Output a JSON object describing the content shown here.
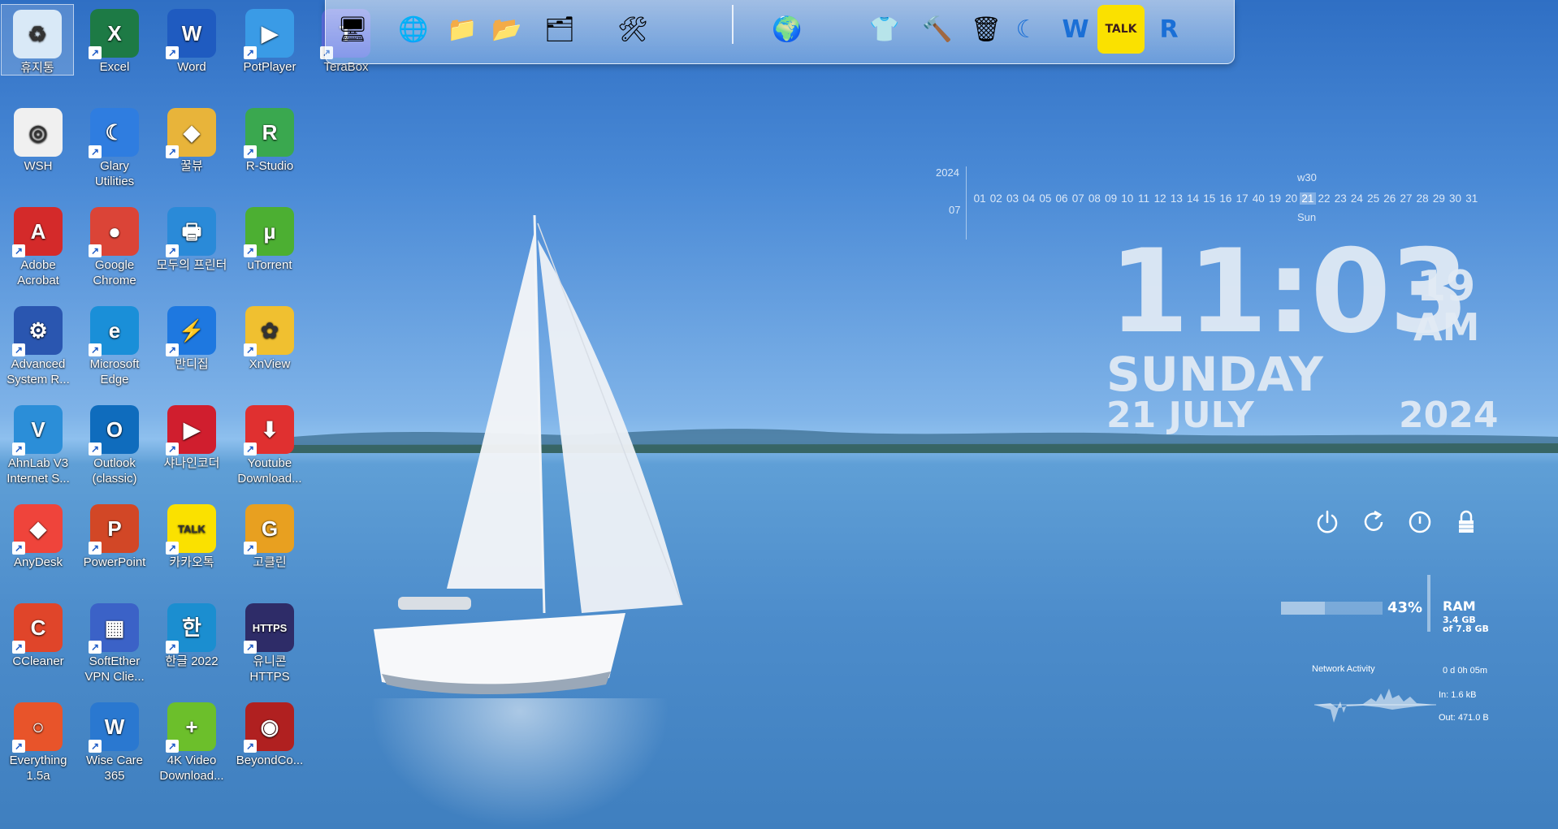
{
  "desktop": {
    "icons": [
      {
        "label": "휴지통",
        "icon": "recycle-bin-icon",
        "color": "#d9e9f7",
        "glyph": "♻"
      },
      {
        "label": "Excel",
        "icon": "excel-icon",
        "color": "#1d7a45",
        "glyph": "X"
      },
      {
        "label": "Word",
        "icon": "word-icon",
        "color": "#1f5bc0",
        "glyph": "W"
      },
      {
        "label": "PotPlayer",
        "icon": "potplayer-icon",
        "color": "#3a9be6",
        "glyph": "▶"
      },
      {
        "label": "TeraBox",
        "icon": "terabox-icon",
        "color": "#5b6de0",
        "glyph": "T"
      },
      {
        "label": "WSH",
        "icon": "wsh-icon",
        "color": "#f0f0f0",
        "glyph": "◎"
      },
      {
        "label": "Glary Utilities",
        "icon": "glary-utilities-icon",
        "color": "#2f7de0",
        "glyph": "☾"
      },
      {
        "label": "꿀뷰",
        "icon": "honeyview-icon",
        "color": "#e8b43a",
        "glyph": "◆"
      },
      {
        "label": "R-Studio",
        "icon": "r-studio-icon",
        "color": "#3aa84f",
        "glyph": "R"
      },
      {
        "label": "Adobe Acrobat",
        "icon": "adobe-acrobat-icon",
        "color": "#d42a2a",
        "glyph": "A"
      },
      {
        "label": "Google Chrome",
        "icon": "chrome-icon",
        "color": "#db4437",
        "glyph": "●"
      },
      {
        "label": "모두의 프린터",
        "icon": "printer-icon",
        "color": "#2a8ad8",
        "glyph": "🖶"
      },
      {
        "label": "uTorrent",
        "icon": "utorrent-icon",
        "color": "#4caf32",
        "glyph": "µ"
      },
      {
        "label": "Advanced System R...",
        "icon": "advanced-system-repair-icon",
        "color": "#2a56b0",
        "glyph": "⚙"
      },
      {
        "label": "Microsoft Edge",
        "icon": "edge-icon",
        "color": "#1a8fd8",
        "glyph": "e"
      },
      {
        "label": "반디집",
        "icon": "bandizip-icon",
        "color": "#1e78e0",
        "glyph": "⚡"
      },
      {
        "label": "XnView",
        "icon": "xnview-icon",
        "color": "#f0c030",
        "glyph": "✿"
      },
      {
        "label": "AhnLab V3 Internet S...",
        "icon": "ahnlab-v3-icon",
        "color": "#2b8ed8",
        "glyph": "V"
      },
      {
        "label": "Outlook (classic)",
        "icon": "outlook-icon",
        "color": "#0f6cbd",
        "glyph": "O"
      },
      {
        "label": "샤나인코더",
        "icon": "shana-encoder-icon",
        "color": "#d01e2e",
        "glyph": "▶"
      },
      {
        "label": "Youtube Download...",
        "icon": "youtube-downloader-icon",
        "color": "#e03030",
        "glyph": "⬇"
      },
      {
        "label": "AnyDesk",
        "icon": "anydesk-icon",
        "color": "#ef443b",
        "glyph": "◆"
      },
      {
        "label": "PowerPoint",
        "icon": "powerpoint-icon",
        "color": "#d24726",
        "glyph": "P"
      },
      {
        "label": "카카오톡",
        "icon": "kakaotalk-icon",
        "color": "#fae100",
        "glyph": "TALK"
      },
      {
        "label": "고클린",
        "icon": "goclean-icon",
        "color": "#e8a020",
        "glyph": "G"
      },
      {
        "label": "CCleaner",
        "icon": "ccleaner-icon",
        "color": "#e0452a",
        "glyph": "C"
      },
      {
        "label": "SoftEther VPN Clie...",
        "icon": "softether-vpn-icon",
        "color": "#3b62c7",
        "glyph": "▦"
      },
      {
        "label": "한글 2022",
        "icon": "hangul-icon",
        "color": "#1b8ed0",
        "glyph": "한"
      },
      {
        "label": "유니콘 HTTPS",
        "icon": "unicorn-https-icon",
        "color": "#2e2c68",
        "glyph": "HTTPS"
      },
      {
        "label": "Everything 1.5a",
        "icon": "everything-search-icon",
        "color": "#e8542a",
        "glyph": "○"
      },
      {
        "label": "Wise Care 365",
        "icon": "wise-care-icon",
        "color": "#2a78d0",
        "glyph": "W"
      },
      {
        "label": "4K Video Download...",
        "icon": "4k-video-downloader-icon",
        "color": "#6cbf2b",
        "glyph": "+"
      },
      {
        "label": "BeyondCo...",
        "icon": "beyond-compare-icon",
        "color": "#b02020",
        "glyph": "◉"
      }
    ]
  },
  "dock": {
    "items": [
      {
        "icon": "computer-icon",
        "glyph": "🖥"
      },
      {
        "icon": "network-globe-icon",
        "glyph": "🌐"
      },
      {
        "icon": "folder-icon",
        "glyph": "📁"
      },
      {
        "icon": "folder-icon",
        "glyph": "📂"
      },
      {
        "icon": "documents-folder-icon",
        "glyph": "🗂"
      },
      {
        "icon": "tools-icon",
        "glyph": "🛠"
      },
      {
        "icon": "globe-icon",
        "glyph": "🌍"
      },
      {
        "icon": "tshirt-icon",
        "glyph": "👕"
      },
      {
        "icon": "hammer-icon",
        "glyph": "🔨"
      },
      {
        "icon": "recycle-bin-icon",
        "glyph": "🗑"
      },
      {
        "icon": "glary-utilities-icon",
        "glyph": "☾"
      },
      {
        "icon": "wise-care-icon",
        "glyph": "W"
      },
      {
        "icon": "kakaotalk-icon",
        "glyph": "TALK"
      },
      {
        "icon": "r-studio-icon",
        "glyph": "R"
      }
    ]
  },
  "calendar": {
    "year": "2024",
    "month": "07",
    "week": "w30",
    "days": [
      "01",
      "02",
      "03",
      "04",
      "05",
      "06",
      "07",
      "08",
      "09",
      "10",
      "11",
      "12",
      "13",
      "14",
      "15",
      "16",
      "17",
      "40",
      "19",
      "20",
      "21",
      "22",
      "23",
      "24",
      "25",
      "26",
      "27",
      "28",
      "29",
      "30",
      "31"
    ],
    "today": "21",
    "dow": "Sun"
  },
  "clock": {
    "time": "11:03",
    "seconds": "19",
    "ampm": "AM",
    "day": "SUNDAY",
    "date": "21 JULY",
    "year": "2024"
  },
  "power_controls": [
    {
      "name": "power-icon",
      "glyph": "⏻"
    },
    {
      "name": "restart-icon",
      "glyph": "⟳"
    },
    {
      "name": "logoff-icon",
      "glyph": "ⓘ"
    },
    {
      "name": "lock-icon",
      "glyph": "🔒"
    }
  ],
  "ram": {
    "percent_text": "43%",
    "percent": 43,
    "label": "RAM",
    "used": "3.4 GB",
    "total": "of 7.8 GB"
  },
  "network": {
    "title": "Network Activity",
    "uptime": "0 d 0h 05m",
    "in": "In: 1.6 kB",
    "out": "Out: 471.0 B"
  }
}
